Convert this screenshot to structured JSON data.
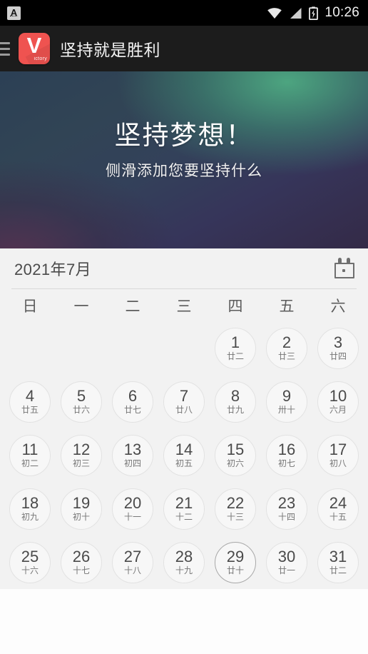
{
  "status_bar": {
    "ime_icon": "ime-a-icon",
    "ime_label": "A",
    "wifi_icon": "wifi-icon",
    "signal_icon": "cellular-signal-icon",
    "battery_icon": "battery-charging-icon",
    "time": "10:26"
  },
  "app_bar": {
    "menu_icon": "hamburger-menu-icon",
    "logo_icon": "app-logo-victory-icon",
    "logo_letter": "V",
    "logo_word": "ictory",
    "title": "坚持就是胜利"
  },
  "hero": {
    "headline": "坚持梦想！",
    "subtitle": "侧滑添加您要坚持什么",
    "gradient_top_right": "#4eaa82",
    "gradient_top_left": "#2c4055",
    "gradient_bottom_left": "#342a47"
  },
  "calendar": {
    "month_label": "2021年7月",
    "calendar_icon": "calendar-icon",
    "weekdays": [
      "日",
      "一",
      "二",
      "三",
      "四",
      "五",
      "六"
    ],
    "today": 29,
    "weeks": [
      [
        {
          "num": "",
          "lunar": "",
          "empty": true
        },
        {
          "num": "",
          "lunar": "",
          "empty": true
        },
        {
          "num": "",
          "lunar": "",
          "empty": true
        },
        {
          "num": "",
          "lunar": "",
          "empty": true
        },
        {
          "num": "1",
          "lunar": "廿二"
        },
        {
          "num": "2",
          "lunar": "廿三"
        },
        {
          "num": "3",
          "lunar": "廿四"
        }
      ],
      [
        {
          "num": "4",
          "lunar": "廿五"
        },
        {
          "num": "5",
          "lunar": "廿六"
        },
        {
          "num": "6",
          "lunar": "廿七"
        },
        {
          "num": "7",
          "lunar": "廿八"
        },
        {
          "num": "8",
          "lunar": "廿九"
        },
        {
          "num": "9",
          "lunar": "卅十"
        },
        {
          "num": "10",
          "lunar": "六月"
        }
      ],
      [
        {
          "num": "11",
          "lunar": "初二"
        },
        {
          "num": "12",
          "lunar": "初三"
        },
        {
          "num": "13",
          "lunar": "初四"
        },
        {
          "num": "14",
          "lunar": "初五"
        },
        {
          "num": "15",
          "lunar": "初六"
        },
        {
          "num": "16",
          "lunar": "初七"
        },
        {
          "num": "17",
          "lunar": "初八"
        }
      ],
      [
        {
          "num": "18",
          "lunar": "初九"
        },
        {
          "num": "19",
          "lunar": "初十"
        },
        {
          "num": "20",
          "lunar": "十一"
        },
        {
          "num": "21",
          "lunar": "十二"
        },
        {
          "num": "22",
          "lunar": "十三"
        },
        {
          "num": "23",
          "lunar": "十四"
        },
        {
          "num": "24",
          "lunar": "十五"
        }
      ],
      [
        {
          "num": "25",
          "lunar": "十六"
        },
        {
          "num": "26",
          "lunar": "十七"
        },
        {
          "num": "27",
          "lunar": "十八"
        },
        {
          "num": "28",
          "lunar": "十九"
        },
        {
          "num": "29",
          "lunar": "廿十",
          "today": true
        },
        {
          "num": "30",
          "lunar": "廿一"
        },
        {
          "num": "31",
          "lunar": "廿二"
        }
      ]
    ]
  }
}
